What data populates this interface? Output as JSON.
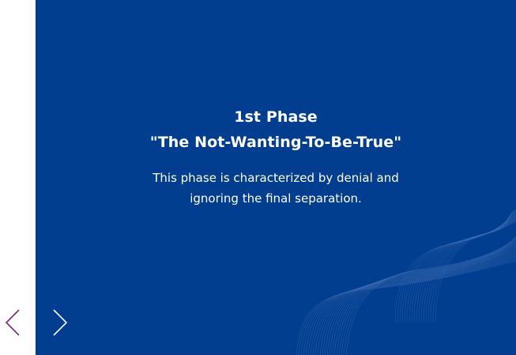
{
  "slide": {
    "title": "1st Phase",
    "subtitle": "\"The Not-Wanting-To-Be-True\"",
    "description": "This phase is characterized by denial and ignoring the final separation.",
    "background_color": "#023e8f",
    "wave_color": "#3f6fb5"
  },
  "navigation": {
    "prev_icon": "chevron-left-icon",
    "next_icon": "chevron-right-icon",
    "prev_color": "#8e1d8e",
    "next_color": "#ffffff"
  }
}
